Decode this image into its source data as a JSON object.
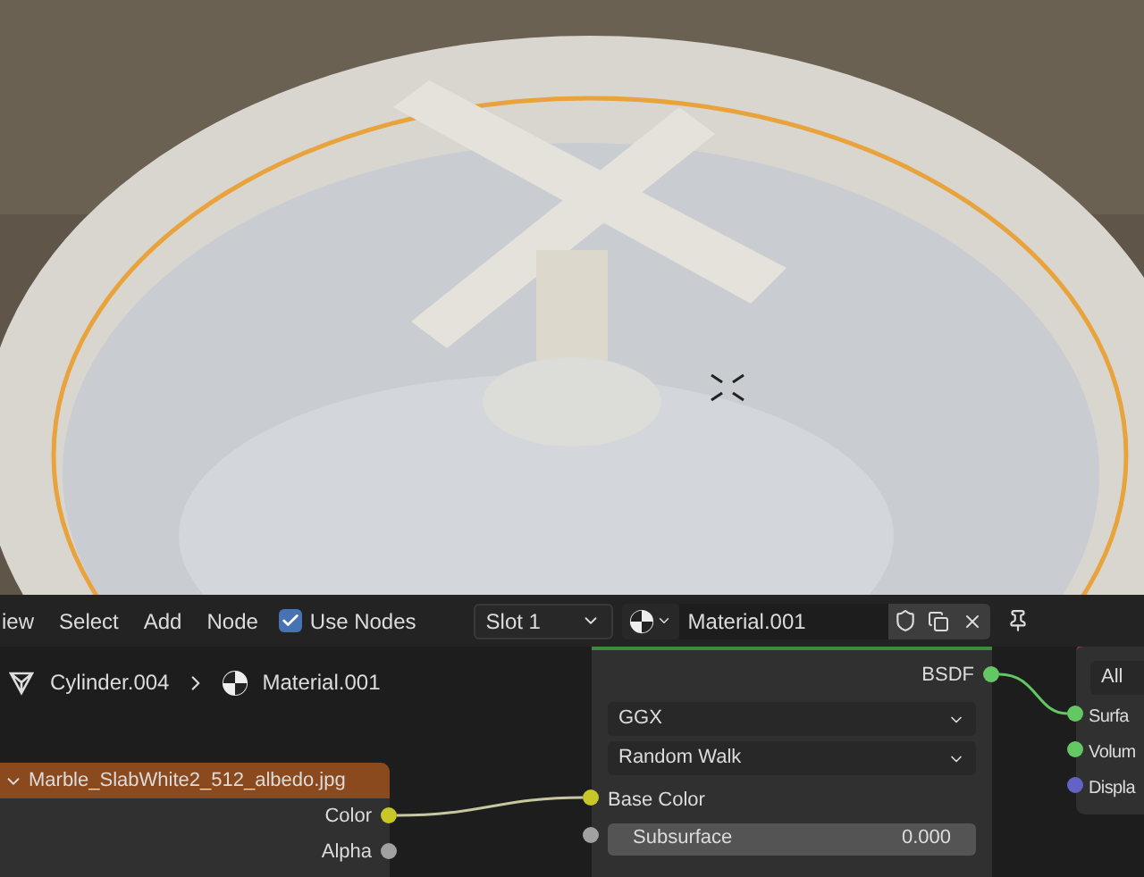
{
  "viewport": {
    "kind": "picture"
  },
  "header": {
    "menus": [
      "iew",
      "Select",
      "Add",
      "Node"
    ],
    "use_nodes": {
      "label": "Use Nodes",
      "checked": true
    },
    "slot": "Slot 1",
    "material": "Material.001"
  },
  "breadcrumb": [
    "Cylinder.004",
    "Material.001"
  ],
  "image_node": {
    "title": "Marble_SlabWhite2_512_albedo.jpg",
    "expanded": true,
    "outputs": [
      {
        "label": "Color",
        "color": "#c7c729"
      },
      {
        "label": "Alpha",
        "color": "#a1a1a1"
      }
    ]
  },
  "bsdf_node": {
    "output": {
      "label": "BSDF",
      "color": "#63c763"
    },
    "dropdowns": [
      "GGX",
      "Random Walk"
    ],
    "inputs": [
      {
        "kind": "socket",
        "label": "Base Color",
        "color": "#c7c729"
      },
      {
        "kind": "slider",
        "label": "Subsurface",
        "value": "0.000",
        "level": 0,
        "color": "#a1a1a1"
      }
    ]
  },
  "output_node": {
    "dropdown": "All",
    "inputs": [
      {
        "label": "Surfa",
        "color": "#63c763"
      },
      {
        "label": "Volum",
        "color": "#63c763"
      },
      {
        "label": "Displa",
        "color": "#6363c7"
      }
    ]
  }
}
